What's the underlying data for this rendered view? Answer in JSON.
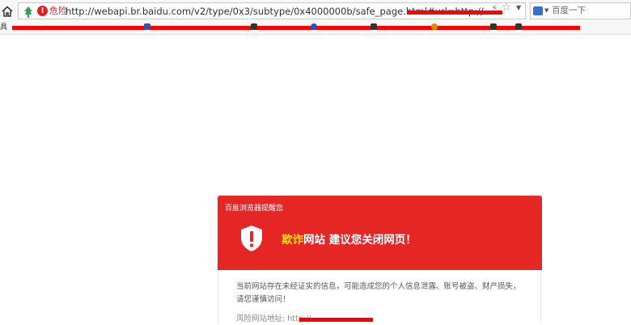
{
  "browser": {
    "security_label": "危险",
    "url": "http://webapi.br.baidu.com/v2/type/0x3/subtype/0x4000000b/safe_page.html#url=http://",
    "search_placeholder": "百度一下",
    "tools_label": "具"
  },
  "colors": {
    "danger_red": "#e62525",
    "highlight_yellow": "#ffe400",
    "redaction": "#ff0000"
  },
  "warning": {
    "brand": "百度浏览器提醒您",
    "headline_fraud": "欺诈",
    "headline_rest": "网站 建议您关闭网页！",
    "body": "当前网站存在未经证实的信息，可能造成您的个人信息泄露、账号被盗、财产损失，请您谨慎访问！",
    "risk_url_label": "风险网站地址: http://"
  },
  "icons": [
    "home-icon",
    "security-shield-icon",
    "danger-icon",
    "lightning-icon",
    "star-icon",
    "dropdown-icon",
    "search-engine-icon",
    "warning-shield-icon"
  ]
}
